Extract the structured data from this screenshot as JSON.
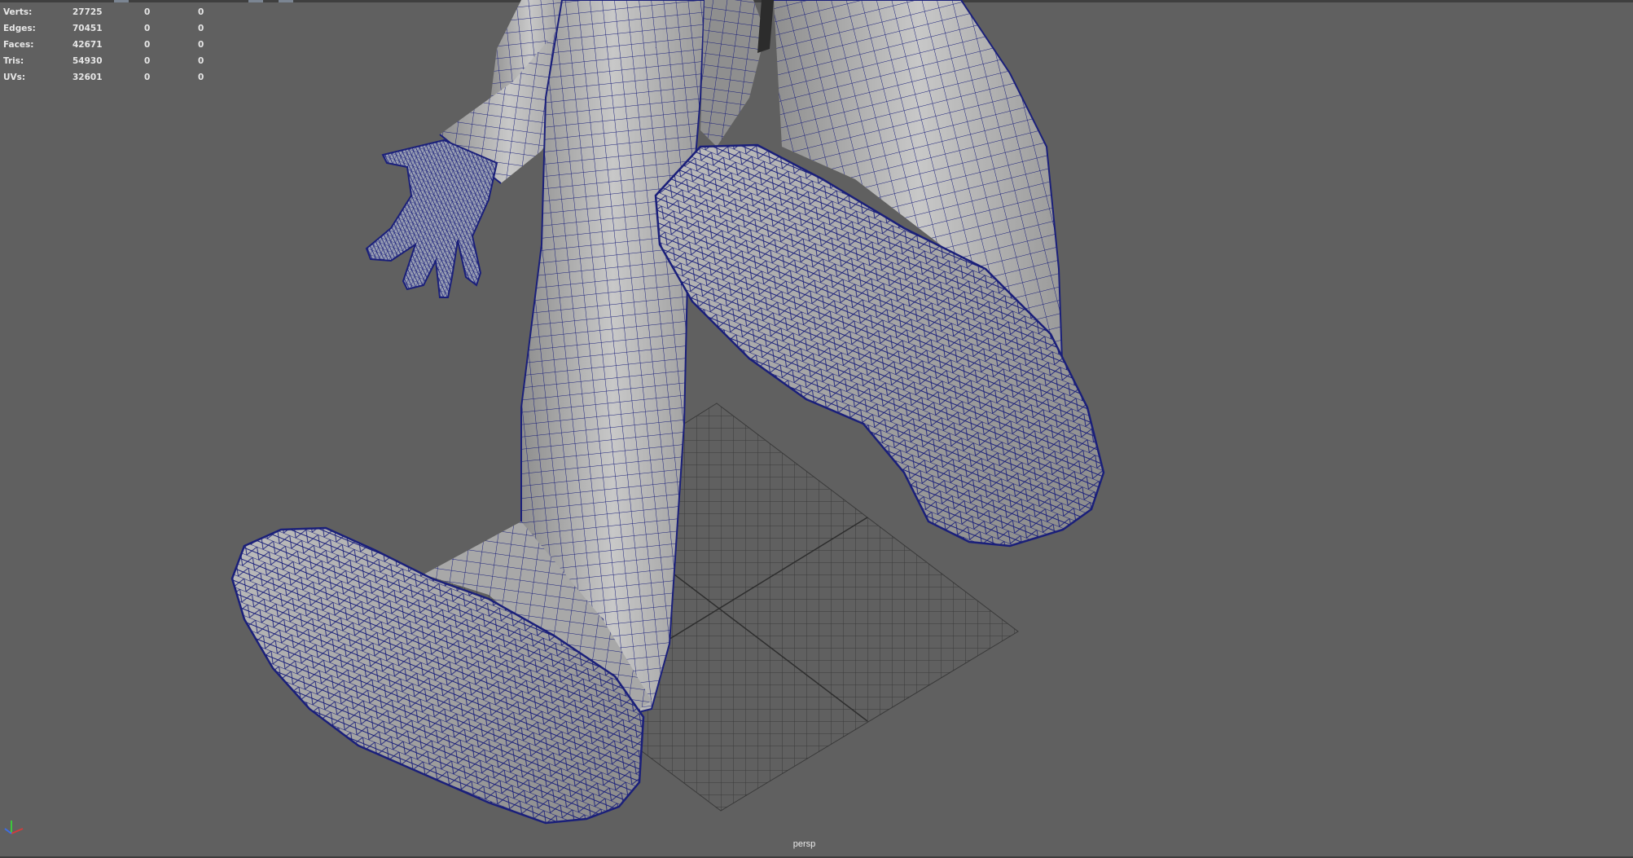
{
  "hud": {
    "rows": [
      {
        "label": "Verts:",
        "v1": "27725",
        "v2": "0",
        "v3": "0"
      },
      {
        "label": "Edges:",
        "v1": "70451",
        "v2": "0",
        "v3": "0"
      },
      {
        "label": "Faces:",
        "v1": "42671",
        "v2": "0",
        "v3": "0"
      },
      {
        "label": "Tris:",
        "v1": "54930",
        "v2": "0",
        "v3": "0"
      },
      {
        "label": "UVs:",
        "v1": "32601",
        "v2": "0",
        "v3": "0"
      }
    ]
  },
  "viewport": {
    "camera_label": "persp",
    "background_color": "#606060",
    "wire_color": "#1a1f7a",
    "surface_color": "#b4b4b4",
    "grid_color": "#3a3a3a"
  },
  "axis_gizmo": {
    "icon": "axis-gizmo-icon",
    "x_color": "#d23c3c",
    "y_color": "#3cc83c",
    "z_color": "#3c6ee6"
  }
}
